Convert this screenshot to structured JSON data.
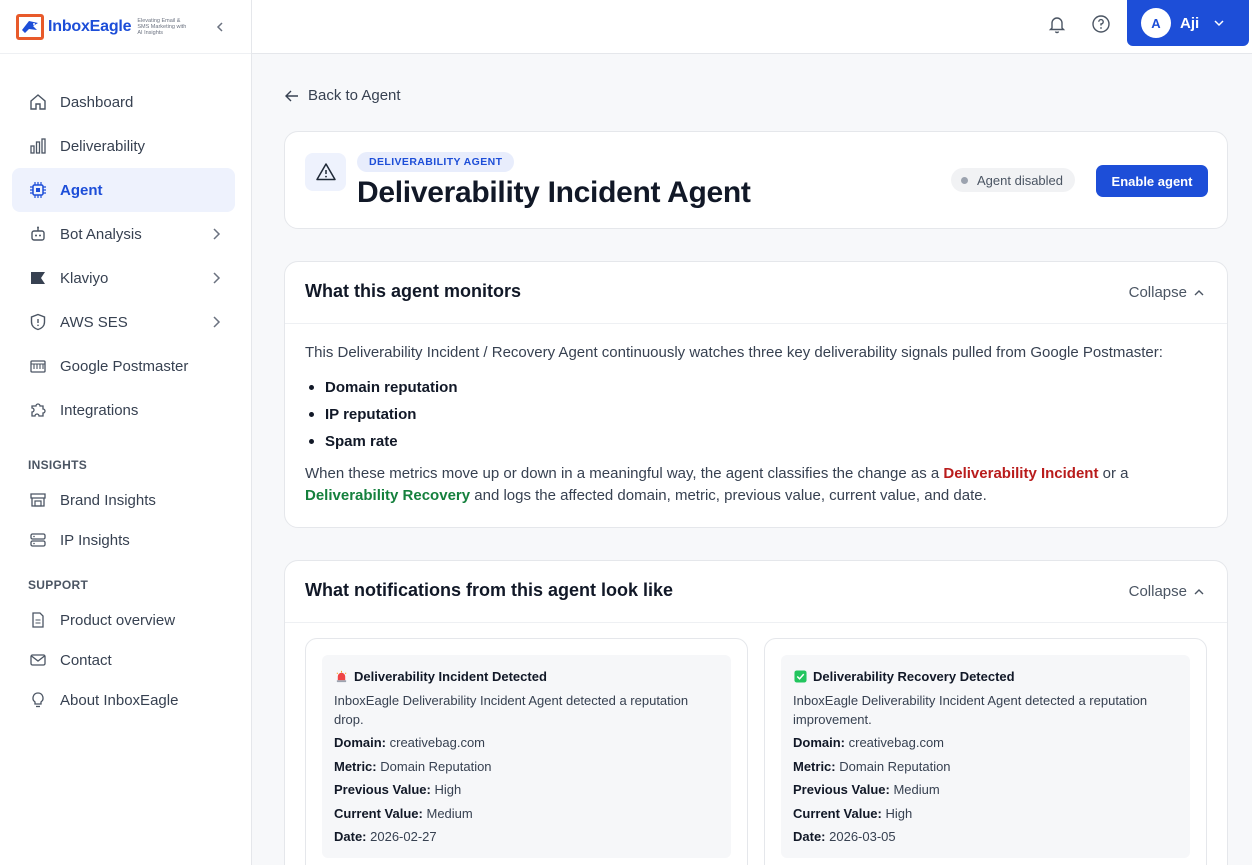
{
  "brand": {
    "name": "InboxEagle",
    "tagline": "Elevating Email & SMS Marketing with AI Insights"
  },
  "sidebar": {
    "items": [
      {
        "label": "Dashboard",
        "icon": "home-icon"
      },
      {
        "label": "Deliverability",
        "icon": "bar-chart-icon"
      },
      {
        "label": "Agent",
        "icon": "chip-icon",
        "active": true
      },
      {
        "label": "Bot Analysis",
        "icon": "bot-icon",
        "has_children": true
      },
      {
        "label": "Klaviyo",
        "icon": "flag-icon",
        "has_children": true
      },
      {
        "label": "AWS SES",
        "icon": "shield-icon",
        "has_children": true
      },
      {
        "label": "Google Postmaster",
        "icon": "mailbox-icon"
      },
      {
        "label": "Integrations",
        "icon": "puzzle-icon"
      }
    ],
    "insights_heading": "INSIGHTS",
    "insights_items": [
      {
        "label": "Brand Insights",
        "icon": "storefront-icon"
      },
      {
        "label": "IP Insights",
        "icon": "server-icon"
      }
    ],
    "support_heading": "SUPPORT",
    "support_items": [
      {
        "label": "Product overview",
        "icon": "document-icon"
      },
      {
        "label": "Contact",
        "icon": "mail-icon"
      },
      {
        "label": "About InboxEagle",
        "icon": "lightbulb-icon"
      }
    ]
  },
  "topbar": {
    "user_initial": "A",
    "user_name": "Aji"
  },
  "main": {
    "back_label": "Back to Agent",
    "header": {
      "pill": "DELIVERABILITY AGENT",
      "title": "Deliverability Incident Agent",
      "status": "Agent disabled",
      "enable_label": "Enable agent"
    },
    "monitors": {
      "title": "What this agent monitors",
      "collapse_label": "Collapse",
      "intro": "This Deliverability Incident / Recovery Agent continuously watches three key deliverability signals pulled from Google Postmaster:",
      "bullets": [
        "Domain reputation",
        "IP reputation",
        "Spam rate"
      ],
      "outro_1": "When these metrics move up or down in a meaningful way, the agent classifies the change as a ",
      "incident_term": "Deliverability Incident",
      "outro_2": " or a ",
      "recovery_term": "Deliverability Recovery",
      "outro_3": " and logs the affected domain, metric, previous value, current value, and date."
    },
    "notifications": {
      "title": "What notifications from this agent look like",
      "collapse_label": "Collapse",
      "labels": {
        "domain": "Domain:",
        "metric": "Metric:",
        "previous": "Previous Value:",
        "current": "Current Value:",
        "date": "Date:"
      },
      "incident": {
        "title": "Deliverability Incident Detected",
        "description": "InboxEagle Deliverability Incident Agent detected a reputation drop.",
        "domain": "creativebag.com",
        "metric": "Domain Reputation",
        "previous": "High",
        "current": "Medium",
        "date": "2026-02-27"
      },
      "recovery": {
        "title": "Deliverability Recovery Detected",
        "description": "InboxEagle Deliverability Incident Agent detected a reputation improvement.",
        "domain": "creativebag.com",
        "metric": "Domain Reputation",
        "previous": "Medium",
        "current": "High",
        "date": "2026-03-05"
      }
    }
  },
  "colors": {
    "accent": "#1d4ed8",
    "incident": "#b91c1c",
    "recovery": "#15803d"
  }
}
